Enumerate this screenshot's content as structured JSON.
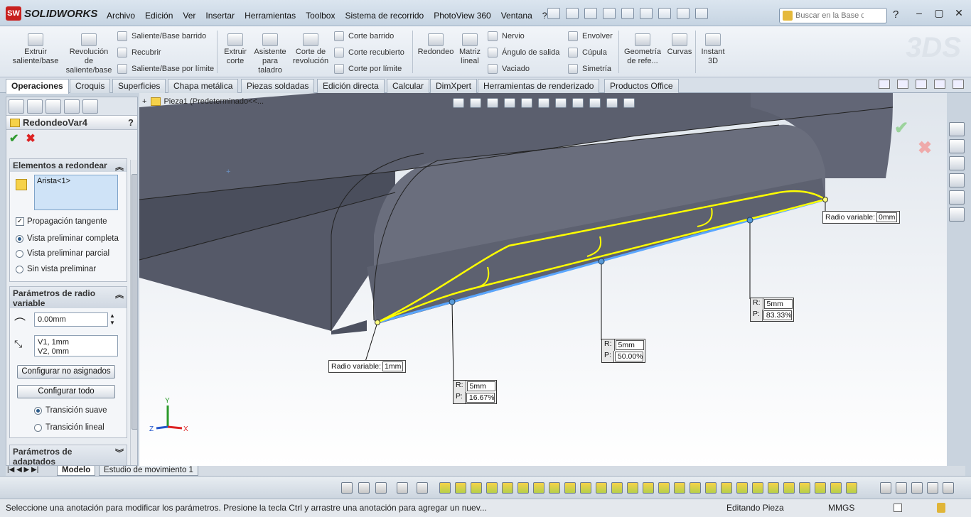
{
  "app": {
    "logo_badge": "SW",
    "logo_text": "SOLIDWORKS"
  },
  "menu": [
    "Archivo",
    "Edición",
    "Ver",
    "Insertar",
    "Herramientas",
    "Toolbox",
    "Sistema de recorrido",
    "PhotoView 360",
    "Ventana",
    "?"
  ],
  "search": {
    "placeholder": "Buscar en la Base d"
  },
  "ribbon": {
    "large": [
      {
        "id": "extruir-saliente",
        "label": "Extruir\nsaliente/base"
      },
      {
        "id": "revolucion-saliente",
        "label": "Revolución\nde\nsaliente/base"
      },
      {
        "id": "extruir-corte",
        "label": "Extruir\ncorte"
      },
      {
        "id": "asistente-taladro",
        "label": "Asistente\npara\ntaladro"
      },
      {
        "id": "corte-revolucion",
        "label": "Corte de\nrevolución"
      },
      {
        "id": "redondeo",
        "label": "Redondeo"
      },
      {
        "id": "matriz-lineal",
        "label": "Matriz\nlineal"
      },
      {
        "id": "geometria-ref",
        "label": "Geometría\nde refe..."
      },
      {
        "id": "curvas",
        "label": "Curvas"
      },
      {
        "id": "instant-3d",
        "label": "Instant\n3D"
      }
    ],
    "small": [
      "Saliente/Base barrido",
      "Recubrir",
      "Saliente/Base por límite",
      "Corte barrido",
      "Corte recubierto",
      "Corte por límite",
      "Nervio",
      "Ángulo de salida",
      "Vaciado",
      "Envolver",
      "Cúpula",
      "Simetría"
    ]
  },
  "tabs": [
    "Operaciones",
    "Croquis",
    "Superficies",
    "Chapa metálica",
    "Piezas soldadas",
    "Edición directa",
    "Calcular",
    "DimXpert",
    "Herramientas de renderizado",
    "Productos Office"
  ],
  "pm": {
    "title": "RedondeoVar4",
    "help": "?",
    "group1": {
      "title": "Elementos a redondear",
      "selection": "Arista<1>",
      "propagation": "Propagación tangente",
      "preview_full": "Vista preliminar completa",
      "preview_partial": "Vista preliminar parcial",
      "preview_none": "Sin vista preliminar"
    },
    "group2": {
      "title": "Parámetros de radio variable",
      "radius_value": "0.00mm",
      "vertices": [
        "V1, 1mm",
        "V2, 0mm"
      ],
      "btn_unassigned": "Configurar no asignados",
      "btn_all": "Configurar todo",
      "smooth": "Transición suave",
      "linear": "Transición lineal"
    },
    "group3": {
      "title": "Parámetros de adaptados"
    }
  },
  "tree": {
    "label": "Pieza1  (Predeterminado<<..."
  },
  "callouts": {
    "rv_left": {
      "label": "Radio variable:",
      "value": "1mm"
    },
    "rv_right": {
      "label": "Radio variable:",
      "value": "0mm"
    },
    "c1": {
      "r_key": "R:",
      "r": "5mm",
      "p_key": "P:",
      "p": "16.67%"
    },
    "c2": {
      "r_key": "R:",
      "r": "5mm",
      "p_key": "P:",
      "p": "50.00%"
    },
    "c3": {
      "r_key": "R:",
      "r": "5mm",
      "p_key": "P:",
      "p": "83.33%"
    }
  },
  "bottom_tabs": [
    "Modelo",
    "Estudio de movimiento 1"
  ],
  "status": {
    "message": "Seleccione una anotación para modificar los parámetros. Presione la tecla Ctrl y arrastre una anotación para agregar un nuev...",
    "mode": "Editando Pieza",
    "units": "MMGS"
  },
  "colors": {
    "edge_highlight": "#ffff00",
    "selected_edge": "#5aa6ff",
    "part_gray": "#5b5f6e"
  }
}
